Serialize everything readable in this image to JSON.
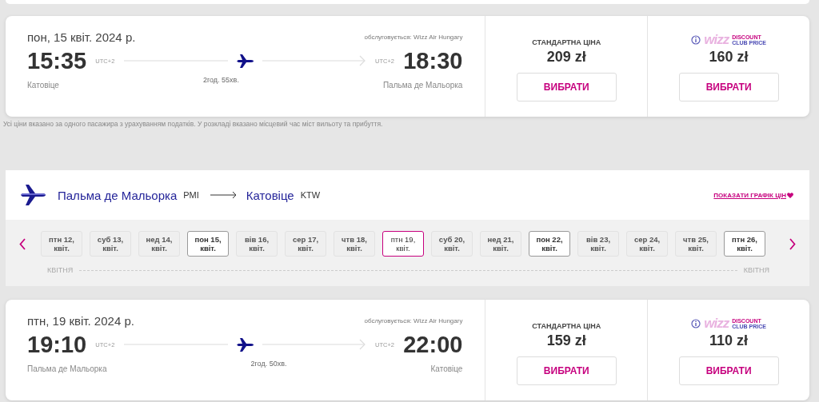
{
  "outbound": {
    "date": "пон, 15 квіт. 2024 р.",
    "operator": "обслуговується: Wizz Air Hungary",
    "departure": {
      "time": "15:35",
      "utc": "UTC+2",
      "city": "Катовіце"
    },
    "arrival": {
      "time": "18:30",
      "utc": "UTC+2",
      "city": "Пальма де Мальорка"
    },
    "duration": "2год. 55хв.",
    "fares": [
      {
        "kind": "standard",
        "label": "СТАНДАРТНА ЦІНА",
        "price": "209 zł",
        "button": "ВИБРАТИ"
      },
      {
        "kind": "club",
        "logo": "wizz",
        "badge_top": "DISCOUNT",
        "badge_bottom": "CLUB PRICE",
        "price": "160 zł",
        "button": "ВИБРАТИ"
      }
    ]
  },
  "note": "Усі ціни вказано за одного пасажира з урахуванням податків. У розкладі вказано місцевий час міст вильоту та прибуття.",
  "return_route": {
    "from": "Пальма де Мальорка",
    "from_code": "PMI",
    "to": "Катовіце",
    "to_code": "KTW",
    "chart_link": "ПОКАЗАТИ ГРАФІК ЦІН",
    "dates": [
      {
        "day": "птн 12,",
        "month": "квіт.",
        "available": false,
        "selected": false
      },
      {
        "day": "суб 13,",
        "month": "квіт.",
        "available": false,
        "selected": false
      },
      {
        "day": "нед 14,",
        "month": "квіт.",
        "available": false,
        "selected": false
      },
      {
        "day": "пон 15,",
        "month": "квіт.",
        "available": true,
        "selected": false
      },
      {
        "day": "вів 16,",
        "month": "квіт.",
        "available": false,
        "selected": false
      },
      {
        "day": "сер 17,",
        "month": "квіт.",
        "available": false,
        "selected": false
      },
      {
        "day": "чтв 18,",
        "month": "квіт.",
        "available": false,
        "selected": false
      },
      {
        "day": "птн 19,",
        "month": "квіт.",
        "available": true,
        "selected": true
      },
      {
        "day": "суб 20,",
        "month": "квіт.",
        "available": false,
        "selected": false
      },
      {
        "day": "нед 21,",
        "month": "квіт.",
        "available": false,
        "selected": false
      },
      {
        "day": "пон 22,",
        "month": "квіт.",
        "available": true,
        "selected": false
      },
      {
        "day": "вів 23,",
        "month": "квіт.",
        "available": false,
        "selected": false
      },
      {
        "day": "сер 24,",
        "month": "квіт.",
        "available": false,
        "selected": false
      },
      {
        "day": "чтв 25,",
        "month": "квіт.",
        "available": false,
        "selected": false
      },
      {
        "day": "птн 26,",
        "month": "квіт.",
        "available": true,
        "selected": false
      }
    ],
    "month_labels": [
      "КВІТНЯ",
      "КВІТНЯ"
    ]
  },
  "return_flight": {
    "date": "птн, 19 квіт. 2024 р.",
    "operator": "обслуговується: Wizz Air Hungary",
    "departure": {
      "time": "19:10",
      "utc": "UTC+2",
      "city": "Пальма де Мальорка"
    },
    "arrival": {
      "time": "22:00",
      "utc": "UTC+2",
      "city": "Катовіце"
    },
    "duration": "2год. 50хв.",
    "fares": [
      {
        "kind": "standard",
        "label": "СТАНДАРТНА ЦІНА",
        "price": "159 zł",
        "button": "ВИБРАТИ"
      },
      {
        "kind": "club",
        "logo": "wizz",
        "badge_top": "DISCOUNT",
        "badge_bottom": "CLUB PRICE",
        "price": "110 zł",
        "button": "ВИБРАТИ"
      }
    ]
  }
}
